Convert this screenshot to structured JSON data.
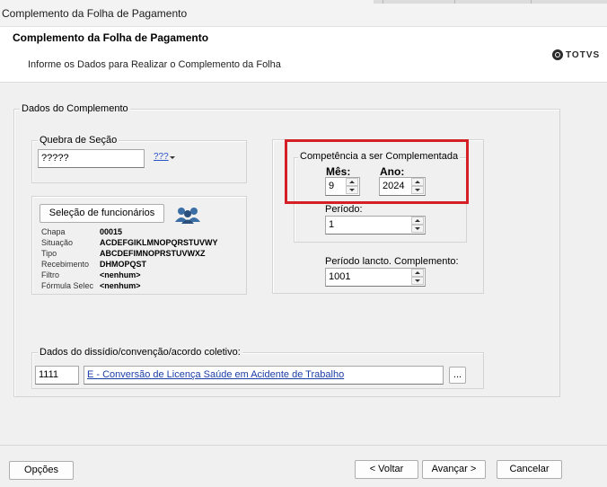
{
  "window": {
    "title": "Complemento da Folha de Pagamento"
  },
  "header": {
    "title": "Complemento da Folha de Pagamento",
    "subtitle": "Informe os Dados para Realizar o Complemento da Folha",
    "logo_text": "TOTVS"
  },
  "dados": {
    "group_label": "Dados do Complemento",
    "quebra": {
      "label": "Quebra de Seção",
      "value": "?????",
      "picker_label": "???"
    },
    "selecao": {
      "button_label": "Seleção de funcionários",
      "icon": "people-icon",
      "rows": [
        {
          "label": "Chapa",
          "value": "00015"
        },
        {
          "label": "Situação",
          "value": "ACDEFGIKLMNOPQRSTUVWY"
        },
        {
          "label": "Tipo",
          "value": "ABCDEFIMNOPRSTUVWXZ"
        },
        {
          "label": "Recebimento",
          "value": "DHMOPQST"
        },
        {
          "label": "Filtro",
          "value": "<nenhum>"
        },
        {
          "label": "Fórmula Selec",
          "value": "<nenhum>"
        }
      ]
    },
    "competencia": {
      "label": "Competência a ser Complementada",
      "mes_label": "Mês:",
      "mes_value": "9",
      "ano_label": "Ano:",
      "ano_value": "2024",
      "periodo_label": "Período:",
      "periodo_value": "1",
      "highlight_color": "#d31f26"
    },
    "periodo_lancto": {
      "label": "Período lancto. Complemento:",
      "value": "1001"
    },
    "dissidio": {
      "label": "Dados do dissídio/convenção/acordo coletivo:",
      "code": "1111",
      "description": "E - Conversão de Licença Saúde em Acidente de Trabalho",
      "browse_label": "..."
    }
  },
  "footer": {
    "opcoes": "Opções",
    "voltar": "< Voltar",
    "avancar": "Avançar >",
    "cancelar": "Cancelar"
  }
}
